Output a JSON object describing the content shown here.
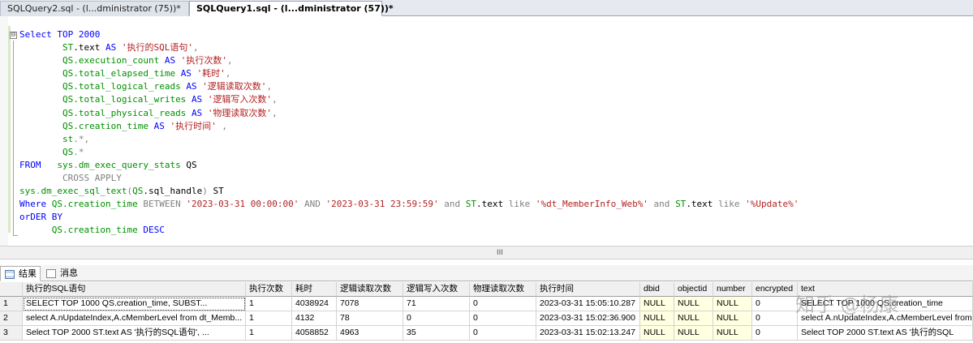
{
  "tabs": [
    {
      "label": "SQLQuery2.sql - (l...dministrator (75))*"
    },
    {
      "label": "SQLQuery1.sql - (l...dministrator (57))*"
    }
  ],
  "editor": {
    "collapse_symbol": "⊟",
    "lines": [
      [
        {
          "t": "Select TOP 2000",
          "c": "kw"
        }
      ],
      [
        {
          "t": "        "
        },
        {
          "t": "ST",
          "c": "sys"
        },
        {
          "t": ".text ",
          "c": "id"
        },
        {
          "t": "AS ",
          "c": "kw"
        },
        {
          "t": "'执行的SQL语句'",
          "c": "str"
        },
        {
          "t": ",",
          "c": "gray"
        }
      ],
      [
        {
          "t": "        "
        },
        {
          "t": "QS",
          "c": "sys"
        },
        {
          "t": ".execution_count ",
          "c": "sys"
        },
        {
          "t": "AS ",
          "c": "kw"
        },
        {
          "t": "'执行次数'",
          "c": "str"
        },
        {
          "t": ",",
          "c": "gray"
        }
      ],
      [
        {
          "t": "        "
        },
        {
          "t": "QS",
          "c": "sys"
        },
        {
          "t": ".total_elapsed_time ",
          "c": "sys"
        },
        {
          "t": "AS ",
          "c": "kw"
        },
        {
          "t": "'耗时'",
          "c": "str"
        },
        {
          "t": ",",
          "c": "gray"
        }
      ],
      [
        {
          "t": "        "
        },
        {
          "t": "QS",
          "c": "sys"
        },
        {
          "t": ".total_logical_reads ",
          "c": "sys"
        },
        {
          "t": "AS ",
          "c": "kw"
        },
        {
          "t": "'逻辑读取次数'",
          "c": "str"
        },
        {
          "t": ",",
          "c": "gray"
        }
      ],
      [
        {
          "t": "        "
        },
        {
          "t": "QS",
          "c": "sys"
        },
        {
          "t": ".total_logical_writes ",
          "c": "sys"
        },
        {
          "t": "AS ",
          "c": "kw"
        },
        {
          "t": "'逻辑写入次数'",
          "c": "str"
        },
        {
          "t": ",",
          "c": "gray"
        }
      ],
      [
        {
          "t": "        "
        },
        {
          "t": "QS",
          "c": "sys"
        },
        {
          "t": ".total_physical_reads ",
          "c": "sys"
        },
        {
          "t": "AS ",
          "c": "kw"
        },
        {
          "t": "'物理读取次数'",
          "c": "str"
        },
        {
          "t": ",",
          "c": "gray"
        }
      ],
      [
        {
          "t": "        "
        },
        {
          "t": "QS",
          "c": "sys"
        },
        {
          "t": ".creation_time ",
          "c": "sys"
        },
        {
          "t": "AS ",
          "c": "kw"
        },
        {
          "t": "'执行时间'",
          "c": "str"
        },
        {
          "t": " ,",
          "c": "gray"
        }
      ],
      [
        {
          "t": "        "
        },
        {
          "t": "st",
          "c": "sys"
        },
        {
          "t": ".*,",
          "c": "gray"
        }
      ],
      [
        {
          "t": "        "
        },
        {
          "t": "QS",
          "c": "sys"
        },
        {
          "t": ".*",
          "c": "gray"
        }
      ],
      [
        {
          "t": "FROM   ",
          "c": "kw"
        },
        {
          "t": "sys",
          "c": "sys"
        },
        {
          "t": ".",
          "c": "gray"
        },
        {
          "t": "dm_exec_query_stats",
          "c": "sys"
        },
        {
          "t": " QS",
          "c": "id"
        }
      ],
      [
        {
          "t": "        "
        },
        {
          "t": "CROSS APPLY",
          "c": "gray"
        }
      ],
      [
        {
          "t": "sys",
          "c": "sys"
        },
        {
          "t": ".",
          "c": "gray"
        },
        {
          "t": "dm_exec_sql_text",
          "c": "sys"
        },
        {
          "t": "(",
          "c": "gray"
        },
        {
          "t": "QS",
          "c": "sys"
        },
        {
          "t": ".sql_handle",
          "c": "id"
        },
        {
          "t": ") ",
          "c": "gray"
        },
        {
          "t": "ST",
          "c": "id"
        }
      ],
      [
        {
          "t": "Where ",
          "c": "kw"
        },
        {
          "t": "QS",
          "c": "sys"
        },
        {
          "t": ".creation_time ",
          "c": "sys"
        },
        {
          "t": "BETWEEN ",
          "c": "gray"
        },
        {
          "t": "'2023-03-31 00:00:00'",
          "c": "str"
        },
        {
          "t": " AND ",
          "c": "gray"
        },
        {
          "t": "'2023-03-31 23:59:59'",
          "c": "str"
        },
        {
          "t": " and ",
          "c": "gray"
        },
        {
          "t": "ST",
          "c": "sys"
        },
        {
          "t": ".text ",
          "c": "id"
        },
        {
          "t": "like ",
          "c": "gray"
        },
        {
          "t": "'%dt_MemberInfo_Web%'",
          "c": "str"
        },
        {
          "t": " and ",
          "c": "gray"
        },
        {
          "t": "ST",
          "c": "sys"
        },
        {
          "t": ".text ",
          "c": "id"
        },
        {
          "t": "like ",
          "c": "gray"
        },
        {
          "t": "'%Update%'",
          "c": "str"
        }
      ],
      [
        {
          "t": "orDER BY",
          "c": "kw"
        }
      ],
      [
        {
          "t": "      "
        },
        {
          "t": "QS",
          "c": "sys"
        },
        {
          "t": ".creation_time ",
          "c": "sys"
        },
        {
          "t": "DESC",
          "c": "kw"
        }
      ]
    ]
  },
  "scroll_grip": "III",
  "result_tabs": [
    {
      "label": "结果"
    },
    {
      "label": "消息"
    }
  ],
  "grid": {
    "columns": [
      "执行的SQL语句",
      "执行次数",
      "耗时",
      "逻辑读取次数",
      "逻辑写入次数",
      "物理读取次数",
      "执行时间",
      "dbid",
      "objectid",
      "number",
      "encrypted",
      "text"
    ],
    "rows": [
      {
        "n": "1",
        "cells": [
          "        SELECT    TOP 1000 QS.creation_time, SUBST...",
          "1",
          "4038924",
          "7078",
          "71",
          "0",
          "2023-03-31 15:05:10.287",
          "NULL",
          "NULL",
          "NULL",
          "0",
          "        SELECT    TOP 1000 QS.creation_time"
        ]
      },
      {
        "n": "2",
        "cells": [
          "select A.nUpdateIndex,A.cMemberLevel  from dt_Memb...",
          "1",
          "4132",
          "78",
          "0",
          "0",
          "2023-03-31 15:02:36.900",
          "NULL",
          "NULL",
          "NULL",
          "0",
          "select A.nUpdateIndex,A.cMemberLevel  from"
        ]
      },
      {
        "n": "3",
        "cells": [
          "Select TOP 2000          ST.text AS '执行的SQL语句',    ...",
          "1",
          "4058852",
          "4963",
          "35",
          "0",
          "2023-03-31 15:02:13.247",
          "NULL",
          "NULL",
          "NULL",
          "0",
          "Select TOP 2000          ST.text AS '执行的SQL"
        ]
      }
    ]
  },
  "watermark": "知乎 @杨康"
}
